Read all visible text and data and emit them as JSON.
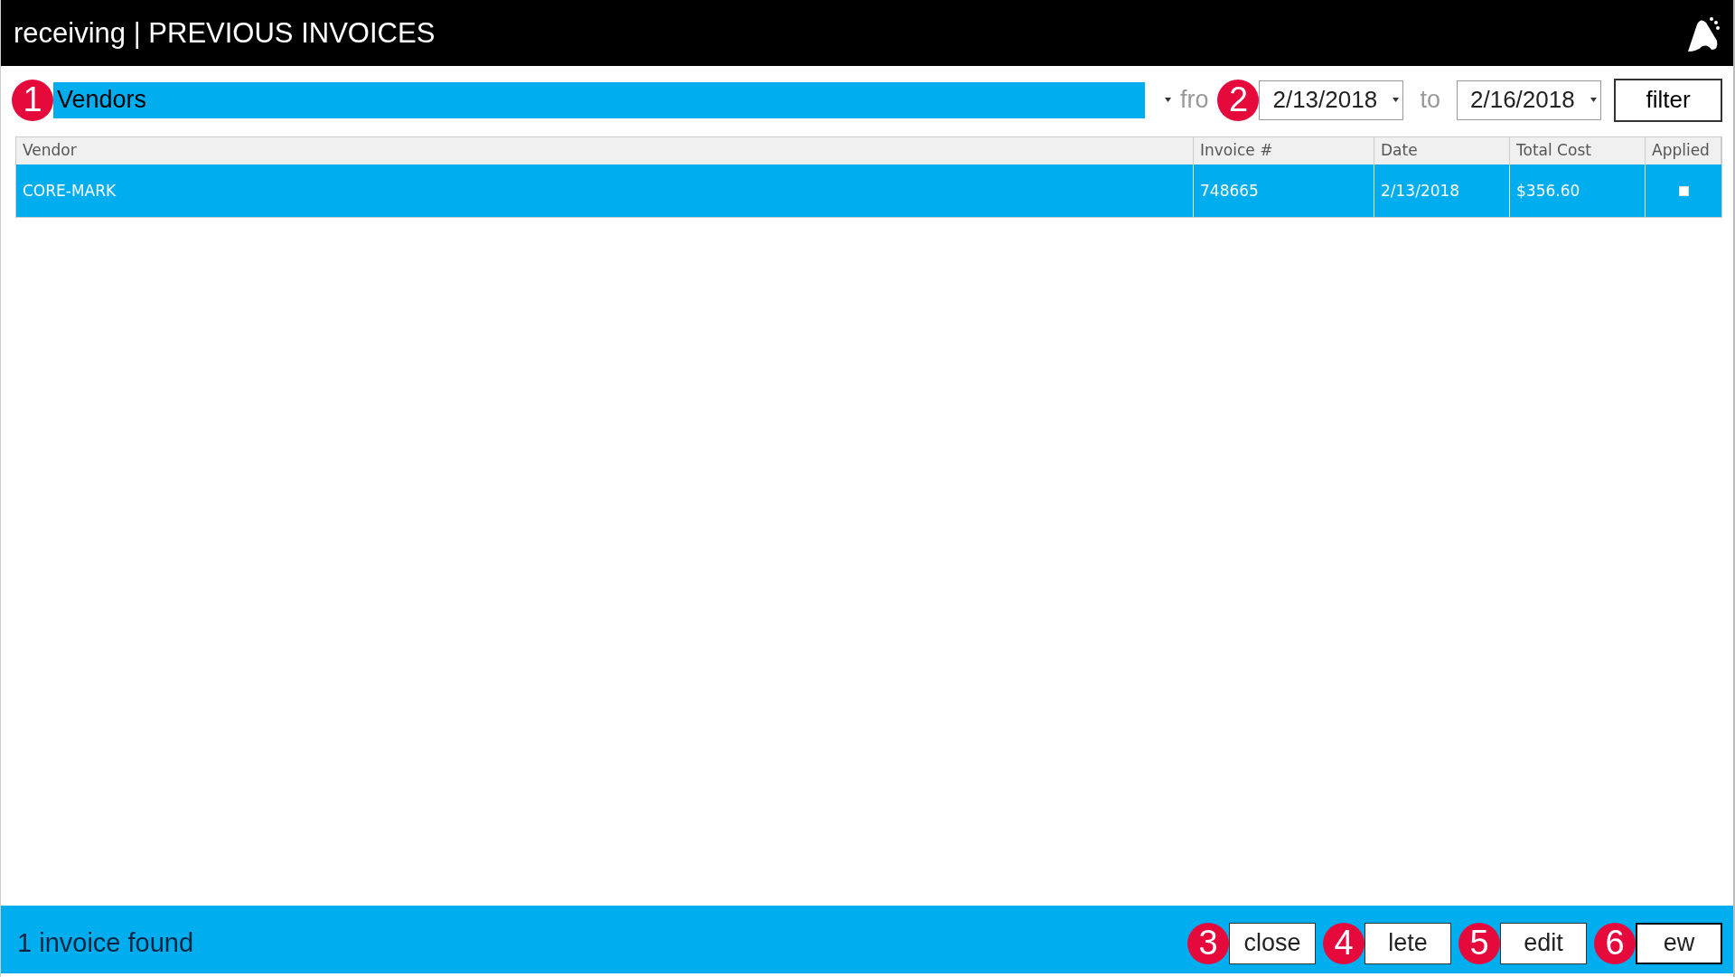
{
  "window": {
    "title": "receiving | PREVIOUS INVOICES"
  },
  "toolbar": {
    "vendor": {
      "value": "Vendors",
      "marker": "1"
    },
    "from_label": "fro",
    "from_date": {
      "value": "2/13/2018",
      "marker": "2"
    },
    "to_label": "to",
    "to_date": {
      "value": "2/16/2018"
    },
    "filter_button": "filter"
  },
  "table": {
    "columns": [
      "Vendor",
      "Invoice #",
      "Date",
      "Total Cost",
      "Applied"
    ],
    "rows": [
      {
        "vendor": "CORE-MARK",
        "invoice": "748665",
        "date": "2/13/2018",
        "total": "$356.60",
        "applied": false,
        "selected": true
      }
    ]
  },
  "status_bar": {
    "text": "1 invoice found",
    "buttons": [
      {
        "label": "close",
        "marker": "3",
        "focused": false
      },
      {
        "label": "lete",
        "marker": "4",
        "focused": false
      },
      {
        "label": "edit",
        "marker": "5",
        "focused": false
      },
      {
        "label": "ew",
        "marker": "6",
        "focused": true
      }
    ]
  }
}
